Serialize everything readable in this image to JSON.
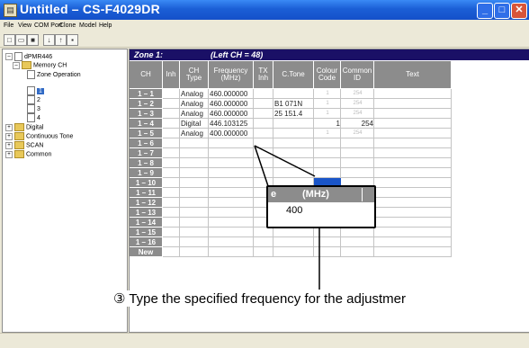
{
  "window": {
    "title": "Untitled – CS-F4029DR",
    "app_icon": "document-icon",
    "buttons": [
      "minimize",
      "maximize",
      "close"
    ]
  },
  "menu": [
    "File",
    "View",
    "COM Port",
    "Clone",
    "Model",
    "Help"
  ],
  "toolbar_icons": [
    "new-icon",
    "open-icon",
    "save-icon",
    "read-icon",
    "write-icon",
    "print-icon"
  ],
  "tree": {
    "root": "dPMR446",
    "memory": "Memory CH",
    "zone_op": "Zone Operation",
    "zones": [
      "1",
      "2",
      "3",
      "4"
    ],
    "digital": "Digital",
    "ctone": "Continuous Tone",
    "scan": "SCAN",
    "common": "Common"
  },
  "zone": {
    "label": "Zone 1:",
    "range": "(Left CH = 48)"
  },
  "columns": {
    "ch": "CH",
    "inh": "Inh",
    "chtype": [
      "CH",
      "Type"
    ],
    "freq": [
      "Frequency",
      "(MHz)"
    ],
    "txinh": [
      "TX",
      "Inh"
    ],
    "ctone": "C.Tone",
    "colour": [
      "Colour",
      "Code"
    ],
    "commonid": [
      "Common",
      "ID"
    ],
    "text": "Text"
  },
  "rows": [
    {
      "ch": "1 – 1",
      "type": "Analog",
      "freq": "460.000000",
      "ctone": "",
      "colour": "1",
      "common": "254"
    },
    {
      "ch": "1 – 2",
      "type": "Analog",
      "freq": "460.000000",
      "ctone": "B1 071N",
      "colour": "1",
      "common": "254"
    },
    {
      "ch": "1 – 3",
      "type": "Analog",
      "freq": "460.000000",
      "ctone": "25 151.4",
      "colour": "1",
      "common": "254"
    },
    {
      "ch": "1 – 4",
      "type": "Digital",
      "freq": "446.103125",
      "ctone": "",
      "colour": "1",
      "common": "254"
    },
    {
      "ch": "1 – 5",
      "type": "Analog",
      "freq": "400.000000",
      "ctone": "",
      "colour": "1",
      "common": "254"
    },
    {
      "ch": "1 – 6"
    },
    {
      "ch": "1 – 7"
    },
    {
      "ch": "1 – 8"
    },
    {
      "ch": "1 – 9"
    },
    {
      "ch": "1 – 10"
    },
    {
      "ch": "1 – 11"
    },
    {
      "ch": "1 – 12"
    },
    {
      "ch": "1 – 13"
    },
    {
      "ch": "1 – 14"
    },
    {
      "ch": "1 – 15"
    },
    {
      "ch": "1 – 16"
    },
    {
      "ch": "New"
    }
  ],
  "zoom": {
    "header_left": "e",
    "header": "(MHz)",
    "value": "400"
  },
  "callout": "③ Type the specified frequency for the adjustmer"
}
